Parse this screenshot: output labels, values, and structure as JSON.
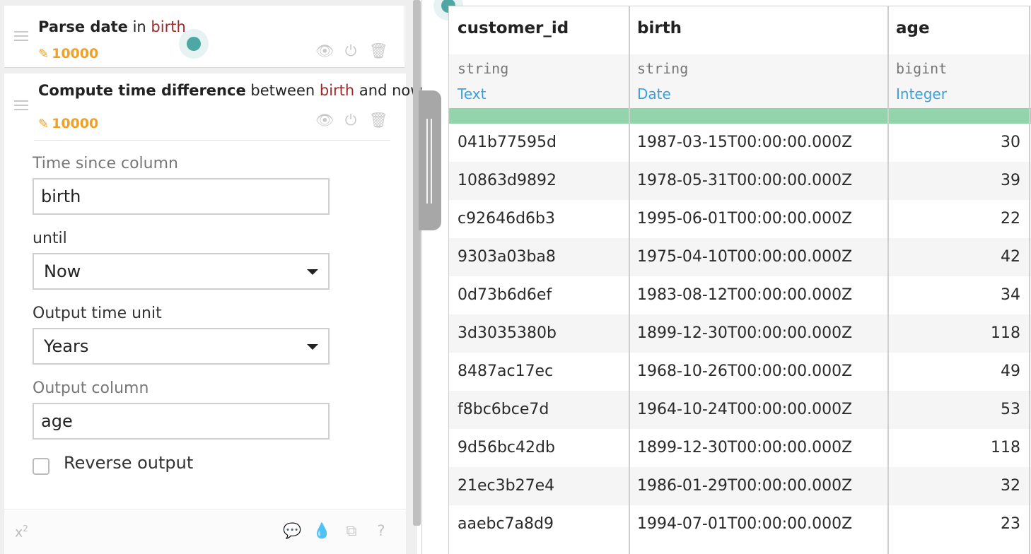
{
  "steps": [
    {
      "title_bold": "Parse date",
      "title_mid": " in ",
      "title_col": "birth",
      "row_count": "10000",
      "icons": [
        "eye-icon",
        "power-icon",
        "trash-icon"
      ]
    },
    {
      "title_bold": "Compute time difference",
      "title_mid": " between ",
      "title_col": "birth",
      "title_end": " and now",
      "row_count": "10000",
      "icons": [
        "eye-icon",
        "power-icon",
        "trash-icon"
      ]
    }
  ],
  "form": {
    "time_since_label": "Time since column",
    "time_since_value": "birth",
    "until_label": "until",
    "until_value": "Now",
    "unit_label": "Output time unit",
    "unit_value": "Years",
    "output_label": "Output column",
    "output_value": "age",
    "reverse_label": "Reverse output",
    "reverse_checked": false
  },
  "footer": {
    "formula_icon": "x",
    "formula_sup": "2",
    "icons": [
      "comment-icon",
      "color-drop-icon",
      "copy-icon",
      "help-icon"
    ]
  },
  "table": {
    "columns": [
      {
        "name": "customer_id",
        "storage_type": "string",
        "meaning": "Text"
      },
      {
        "name": "birth",
        "storage_type": "string",
        "meaning": "Date"
      },
      {
        "name": "age",
        "storage_type": "bigint",
        "meaning": "Integer"
      }
    ],
    "rows": [
      [
        "041b77595d",
        "1987-03-15T00:00:00.000Z",
        "30"
      ],
      [
        "10863d9892",
        "1978-05-31T00:00:00.000Z",
        "39"
      ],
      [
        "c92646d6b3",
        "1995-06-01T00:00:00.000Z",
        "22"
      ],
      [
        "9303a03ba8",
        "1975-04-10T00:00:00.000Z",
        "42"
      ],
      [
        "0d73b6d6ef",
        "1983-08-12T00:00:00.000Z",
        "34"
      ],
      [
        "3d3035380b",
        "1899-12-30T00:00:00.000Z",
        "118"
      ],
      [
        "8487ac17ec",
        "1968-10-26T00:00:00.000Z",
        "49"
      ],
      [
        "f8bc6bce7d",
        "1964-10-24T00:00:00.000Z",
        "53"
      ],
      [
        "9d56bc42db",
        "1899-12-30T00:00:00.000Z",
        "118"
      ],
      [
        "21ec3b27e4",
        "1986-01-29T00:00:00.000Z",
        "32"
      ],
      [
        "aaebc7a8d9",
        "1994-07-01T00:00:00.000Z",
        "23"
      ]
    ]
  },
  "colors": {
    "accent_orange": "#f0a024",
    "column_ref_red": "#9b2a2a",
    "meaning_blue": "#3f9fd8",
    "quality_green": "#94d4ad",
    "teal_dot": "#4da8a4"
  }
}
